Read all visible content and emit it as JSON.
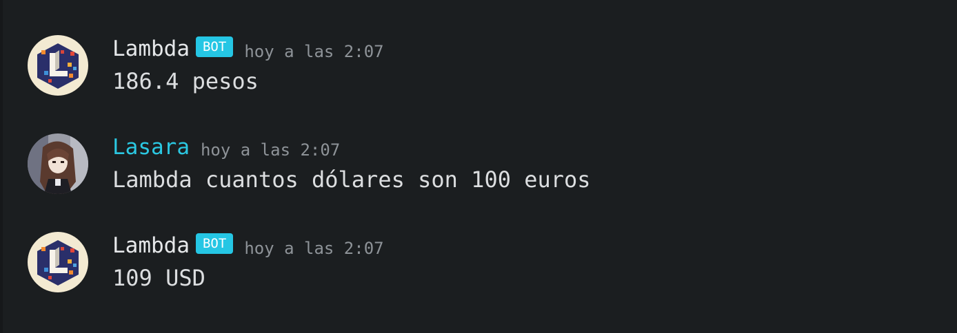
{
  "messages": [
    {
      "author": "Lambda",
      "is_bot": true,
      "badge": "BOT",
      "timestamp": "hoy a las 2:07",
      "content": "186.4 pesos",
      "avatar_icon": "lambda-bot-avatar-icon"
    },
    {
      "author": "Lasara",
      "is_bot": false,
      "timestamp": "hoy a las 2:07",
      "content": "Lambda cuantos dólares son 100 euros",
      "avatar_icon": "anime-girl-avatar-icon"
    },
    {
      "author": "Lambda",
      "is_bot": true,
      "badge": "BOT",
      "timestamp": "hoy a las 2:07",
      "content": "109 USD",
      "avatar_icon": "lambda-bot-avatar-icon"
    }
  ],
  "colors": {
    "background": "#1b1e20",
    "bot_name": "#e6e8ea",
    "user_name": "#2bc8e2",
    "badge_bg": "#25c6e4",
    "timestamp": "#8e9398",
    "message_text": "#dcdee0"
  }
}
